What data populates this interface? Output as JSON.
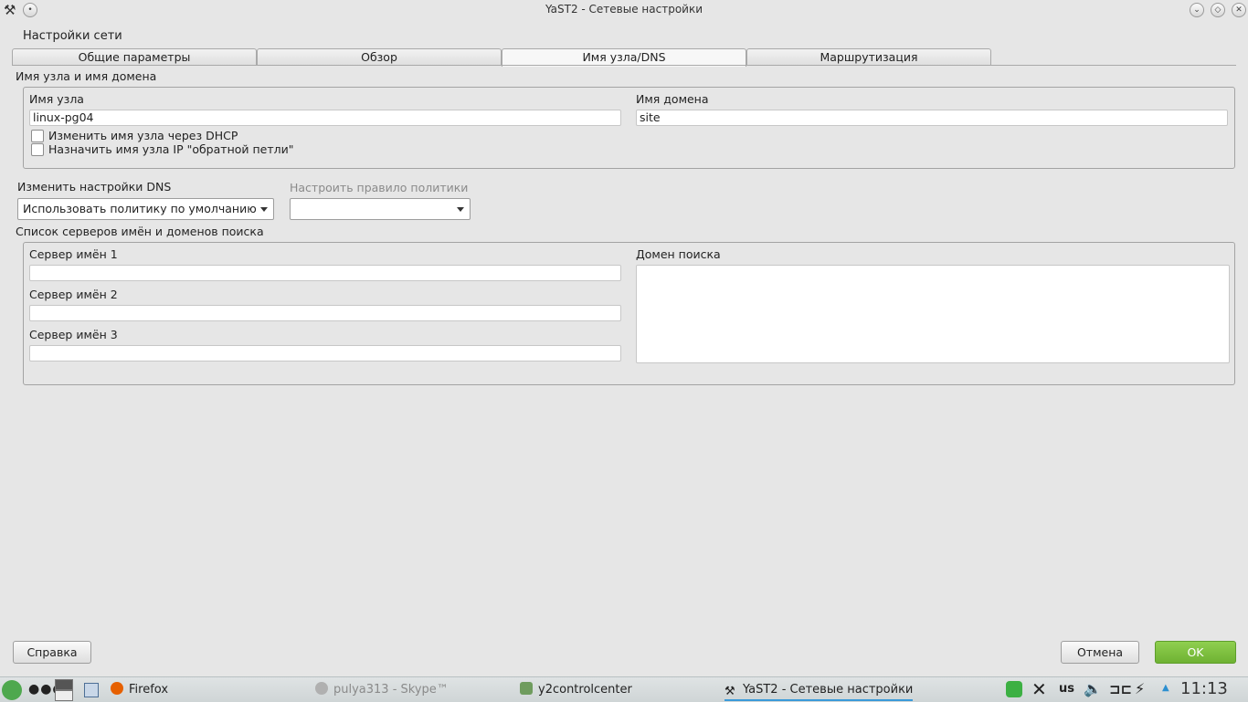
{
  "window": {
    "title": "YaST2 - Сетевые настройки",
    "heading": "Настройки сети"
  },
  "tabs": [
    {
      "label": "Общие параметры"
    },
    {
      "label": "Обзор"
    },
    {
      "label": "Имя узла/DNS",
      "active": true
    },
    {
      "label": "Маршрутизация"
    }
  ],
  "hostname_group": {
    "title": "Имя узла и имя домена",
    "hostname_label": "Имя узла",
    "hostname_value": "linux-pg04",
    "domain_label": "Имя домена",
    "domain_value": "site",
    "dhcp_checkbox": "Изменить имя узла через DHCP",
    "loopback_checkbox": "Назначить имя узла IP \"обратной петли\""
  },
  "dns_settings": {
    "label": "Изменить настройки DNS",
    "value": "Использовать политику по умолчанию",
    "policy_label": "Настроить правило политики",
    "policy_value": ""
  },
  "servers_group": {
    "title": "Список серверов имён и доменов поиска",
    "ns1_label": "Сервер имён 1",
    "ns2_label": "Сервер имён 2",
    "ns3_label": "Сервер имён 3",
    "search_label": "Домен поиска"
  },
  "buttons": {
    "help": "Справка",
    "cancel": "Отмена",
    "ok": "OK"
  },
  "taskbar": {
    "firefox": "Firefox",
    "skype": "pulya313 - Skype™",
    "control_center": "y2controlcenter",
    "yast": "YaST2 - Сетевые настройки",
    "keyboard": "us",
    "clock": "11:13"
  }
}
